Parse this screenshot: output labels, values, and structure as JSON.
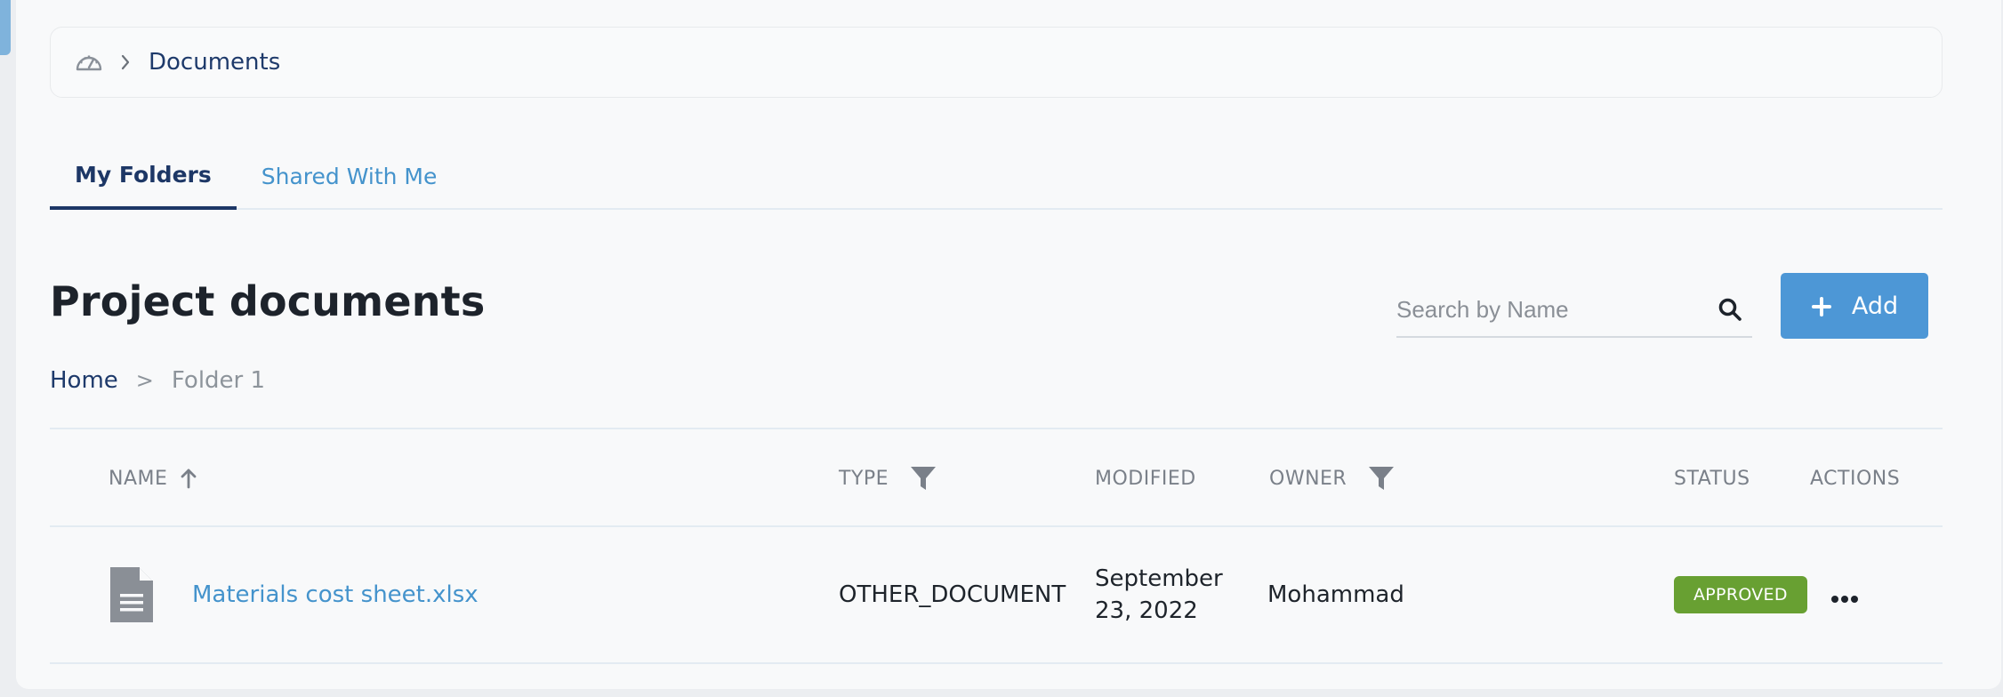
{
  "breadcrumb": {
    "icon": "dashboard-icon",
    "separator_icon": "chevron-right-icon",
    "current": "Documents"
  },
  "tabs": [
    {
      "label": "My Folders",
      "active": true
    },
    {
      "label": "Shared With Me",
      "active": false
    }
  ],
  "page": {
    "title": "Project documents"
  },
  "search": {
    "placeholder": "Search by Name",
    "value": "",
    "icon": "search-icon"
  },
  "add_button": {
    "label": "Add",
    "icon": "plus-icon"
  },
  "folder_breadcrumb": {
    "home": "Home",
    "separator": ">",
    "current": "Folder 1"
  },
  "table": {
    "columns": {
      "name": "NAME",
      "type": "TYPE",
      "modified": "MODIFIED",
      "owner": "OWNER",
      "status": "STATUS",
      "actions": "ACTIONS"
    },
    "rows": [
      {
        "icon": "file-document-icon",
        "name": "Materials cost sheet.xlsx",
        "type": "OTHER_DOCUMENT",
        "modified_line1": "September",
        "modified_line2": "23, 2022",
        "owner": "Mohammad",
        "status": "APPROVED",
        "actions_icon": "more-horizontal-icon"
      }
    ]
  },
  "colors": {
    "primary": "#1d3766",
    "accent": "#4493cc",
    "button": "#4d97d6",
    "approved": "#68a032"
  }
}
